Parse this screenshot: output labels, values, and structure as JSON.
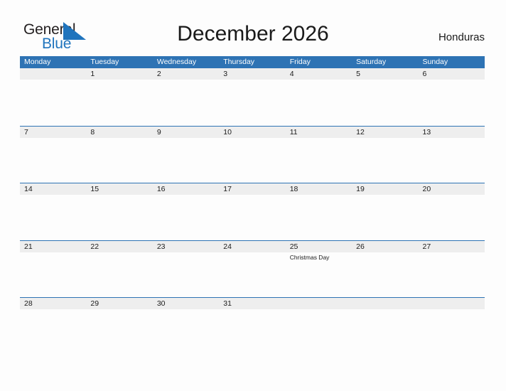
{
  "brand": {
    "name_part1": "General",
    "name_part2": "Blue",
    "mark_icon": "blue-triangle-flag-icon",
    "color_primary": "#1f74bd",
    "color_text": "#231f20"
  },
  "header": {
    "title": "December 2026",
    "region": "Honduras"
  },
  "calendar": {
    "header_color": "#2e73b4",
    "band_color": "#eeeeee",
    "weekdays": [
      "Monday",
      "Tuesday",
      "Wednesday",
      "Thursday",
      "Friday",
      "Saturday",
      "Sunday"
    ],
    "weeks": [
      [
        {
          "day": "",
          "events": []
        },
        {
          "day": "1",
          "events": []
        },
        {
          "day": "2",
          "events": []
        },
        {
          "day": "3",
          "events": []
        },
        {
          "day": "4",
          "events": []
        },
        {
          "day": "5",
          "events": []
        },
        {
          "day": "6",
          "events": []
        }
      ],
      [
        {
          "day": "7",
          "events": []
        },
        {
          "day": "8",
          "events": []
        },
        {
          "day": "9",
          "events": []
        },
        {
          "day": "10",
          "events": []
        },
        {
          "day": "11",
          "events": []
        },
        {
          "day": "12",
          "events": []
        },
        {
          "day": "13",
          "events": []
        }
      ],
      [
        {
          "day": "14",
          "events": []
        },
        {
          "day": "15",
          "events": []
        },
        {
          "day": "16",
          "events": []
        },
        {
          "day": "17",
          "events": []
        },
        {
          "day": "18",
          "events": []
        },
        {
          "day": "19",
          "events": []
        },
        {
          "day": "20",
          "events": []
        }
      ],
      [
        {
          "day": "21",
          "events": []
        },
        {
          "day": "22",
          "events": []
        },
        {
          "day": "23",
          "events": []
        },
        {
          "day": "24",
          "events": []
        },
        {
          "day": "25",
          "events": [
            "Christmas Day"
          ]
        },
        {
          "day": "26",
          "events": []
        },
        {
          "day": "27",
          "events": []
        }
      ],
      [
        {
          "day": "28",
          "events": []
        },
        {
          "day": "29",
          "events": []
        },
        {
          "day": "30",
          "events": []
        },
        {
          "day": "31",
          "events": []
        },
        {
          "day": "",
          "events": []
        },
        {
          "day": "",
          "events": []
        },
        {
          "day": "",
          "events": []
        }
      ]
    ]
  }
}
